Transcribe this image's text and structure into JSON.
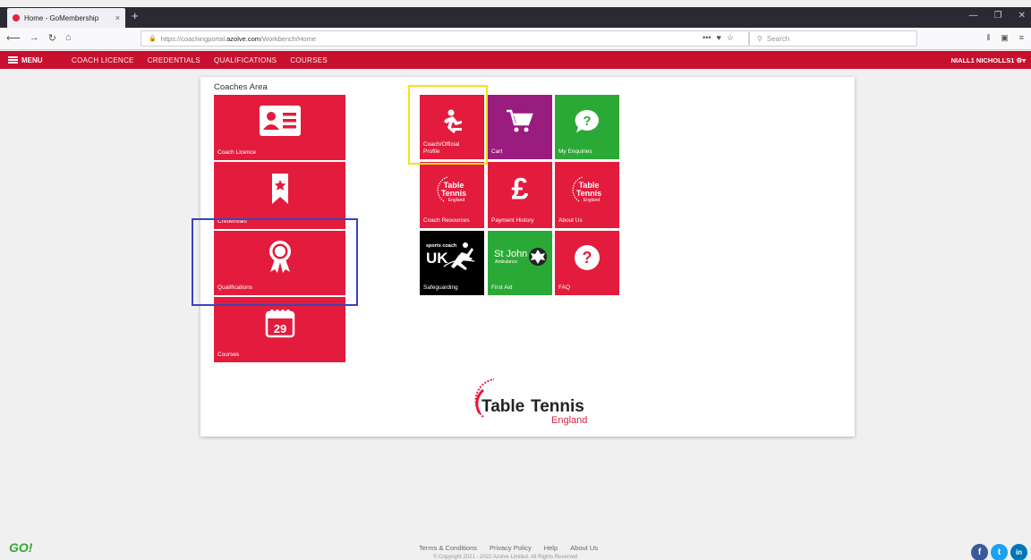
{
  "browser": {
    "tab_title": "Home - GoMembership",
    "tab_close": "×",
    "new_tab": "+",
    "url_prefix": "https://coachingportal.",
    "url_host": "azolve.com",
    "url_path": "/Workbench/Home",
    "search_placeholder": "Search"
  },
  "app_header": {
    "menu_label": "MENU",
    "nav": [
      "COACH LICENCE",
      "CREDENTIALS",
      "QUALIFICATIONS",
      "COURSES"
    ],
    "user": "NIALL1 NICHOLLS1"
  },
  "coaches_area": {
    "title": "Coaches Area",
    "tiles": [
      {
        "label": "Coach Licence",
        "icon": "id-card-icon"
      },
      {
        "label": "Credentials",
        "icon": "bookmark-star-icon"
      },
      {
        "label": "Qualifications",
        "icon": "award-ribbon-icon"
      },
      {
        "label": "Courses",
        "icon": "calendar-icon",
        "icon_text": "29"
      }
    ]
  },
  "grid": {
    "tiles": [
      {
        "label": "Coach/Official\nProfile",
        "icon": "running-person-icon",
        "color": "#e31c3d"
      },
      {
        "label": "Cart",
        "icon": "cart-icon",
        "color": "#9a1c7f"
      },
      {
        "label": "My Enquiries",
        "icon": "question-bubble-icon",
        "color": "#2ba936"
      },
      {
        "label": "Coach Resources",
        "icon": "table-tennis-england-logo",
        "color": "#e31c3d"
      },
      {
        "label": "Payment History",
        "icon": "pound-icon",
        "color": "#e31c3d"
      },
      {
        "label": "About Us",
        "icon": "table-tennis-england-logo",
        "color": "#e31c3d"
      },
      {
        "label": "Safeguarding",
        "icon": "sports-coach-uk-logo",
        "color": "#000000"
      },
      {
        "label": "First Aid",
        "icon": "st-john-ambulance-logo",
        "color": "#2ba936"
      },
      {
        "label": "FAQ",
        "icon": "question-circle-icon",
        "color": "#e31c3d"
      }
    ]
  },
  "logo_text": {
    "table": "Table",
    "tennis": "Tennis",
    "england": "England"
  },
  "tile_logo_text": {
    "line1": "Table",
    "line2": "Tennis",
    "line3": "England"
  },
  "st_john": {
    "name": "St John",
    "sub": "Ambulance"
  },
  "sports_coach": {
    "top": "sports coach",
    "uk": "UK"
  },
  "footer": {
    "logo": "GO!",
    "links": [
      "Terms & Conditions",
      "Privacy Policy",
      "Help",
      "About Us"
    ],
    "copyright": "© Copyright 2021 - 2022 Azolve Limited. All Rights Reserved"
  },
  "colors": {
    "brand_red": "#c8102e",
    "tile_red": "#e31c3d",
    "purple": "#9a1c7f",
    "green": "#2ba936"
  }
}
